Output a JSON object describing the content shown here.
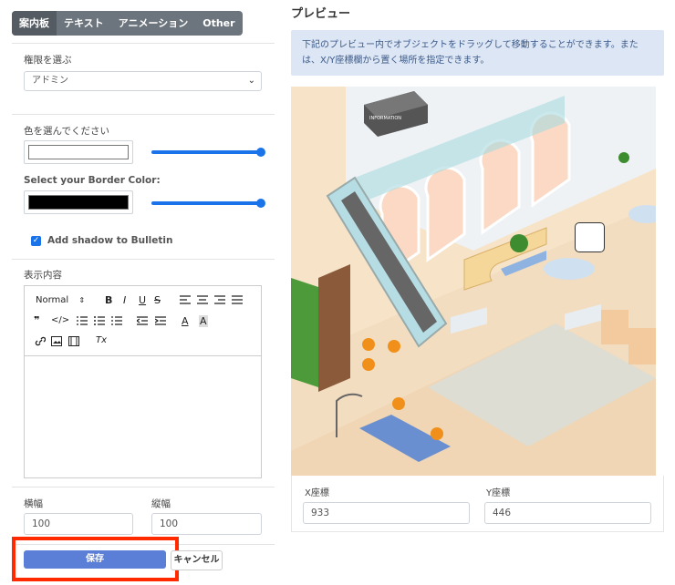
{
  "tabs": [
    "案内板",
    "テキスト",
    "アニメーション",
    "Other"
  ],
  "permission": {
    "label": "権限を選ぶ",
    "value": "アドミン"
  },
  "color": {
    "label": "色を選んでください",
    "value": "#ffffff"
  },
  "border_color": {
    "label": "Select your Border Color:",
    "value": "#000000"
  },
  "shadow": {
    "label": "Add shadow to Bulletin",
    "checked": true
  },
  "content": {
    "label": "表示内容",
    "toolbar": {
      "header": "Normal",
      "bold": "B",
      "italic": "I",
      "underline": "U",
      "strike": "S",
      "quote": "❞",
      "code": "</>",
      "text_color": "A",
      "bg_color": "A",
      "clean": "Tx"
    }
  },
  "width": {
    "label": "横幅",
    "value": "100"
  },
  "height": {
    "label": "縦幅",
    "value": "100"
  },
  "buttons": {
    "save": "保存",
    "cancel": "キャンセル"
  },
  "preview": {
    "title": "プレビュー",
    "info": "下記のプレビュー内でオブジェクトをドラッグして移動することができます。または、X/Y座標欄から置く場所を指定できます。",
    "sign_text": "INFORMATION",
    "x_label": "X座標",
    "x_value": "933",
    "y_label": "Y座標",
    "y_value": "446"
  },
  "colors": {
    "accent": "#1a73e8",
    "save": "#5b7fd6",
    "highlight": "#ff2a00",
    "tabs": "#6c757d"
  }
}
